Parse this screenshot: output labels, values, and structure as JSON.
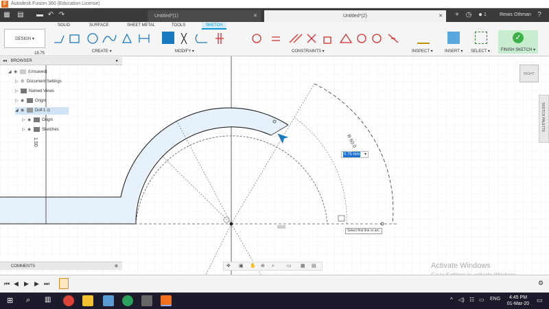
{
  "window": {
    "title": "Autodesk Fusion 360 (Education License)",
    "logo": "F"
  },
  "tabs": [
    {
      "label": "Untitled*(1)"
    },
    {
      "label": "Untitled*(2)"
    }
  ],
  "user": {
    "name": "Rewis Othman",
    "notifications": "1"
  },
  "workspace": {
    "label": "DESIGN"
  },
  "ribbon_tabs": [
    "SOLID",
    "SURFACE",
    "SHEET METAL",
    "TOOLS",
    "SKETCH"
  ],
  "groups": {
    "create": "CREATE",
    "modify": "MODIFY",
    "constraints": "CONSTRAINTS",
    "inspect": "INSPECT",
    "insert": "INSERT",
    "select": "SELECT",
    "finish": "FINISH SKETCH"
  },
  "browser": {
    "title": "BROWSER",
    "items": [
      {
        "label": "(Unsaved)"
      },
      {
        "label": "Document Settings"
      },
      {
        "label": "Named Views"
      },
      {
        "label": "Origin"
      },
      {
        "label": "Doll:1"
      },
      {
        "label": "Origin"
      },
      {
        "label": "Sketches"
      }
    ]
  },
  "comments": {
    "label": "COMMENTS"
  },
  "sketch": {
    "dim_radius": "R 60.0",
    "dim_height": "1.50",
    "input_value": "0.75 mm",
    "tooltip": "Select first line or arc.",
    "viewcube": "RIGHT",
    "palette": "SKETCH PALETTE",
    "top_dim": "18.75"
  },
  "watermark": {
    "line1": "Activate Windows",
    "line2": "Go to Settings to activate Windows."
  },
  "taskbar": {
    "time": "4:45 PM",
    "date": "01-Mar-20",
    "lang": "ENG"
  },
  "colors": {
    "accent": "#0696d7",
    "finish": "#3db04a",
    "taskbar": "#1b1b2b"
  }
}
